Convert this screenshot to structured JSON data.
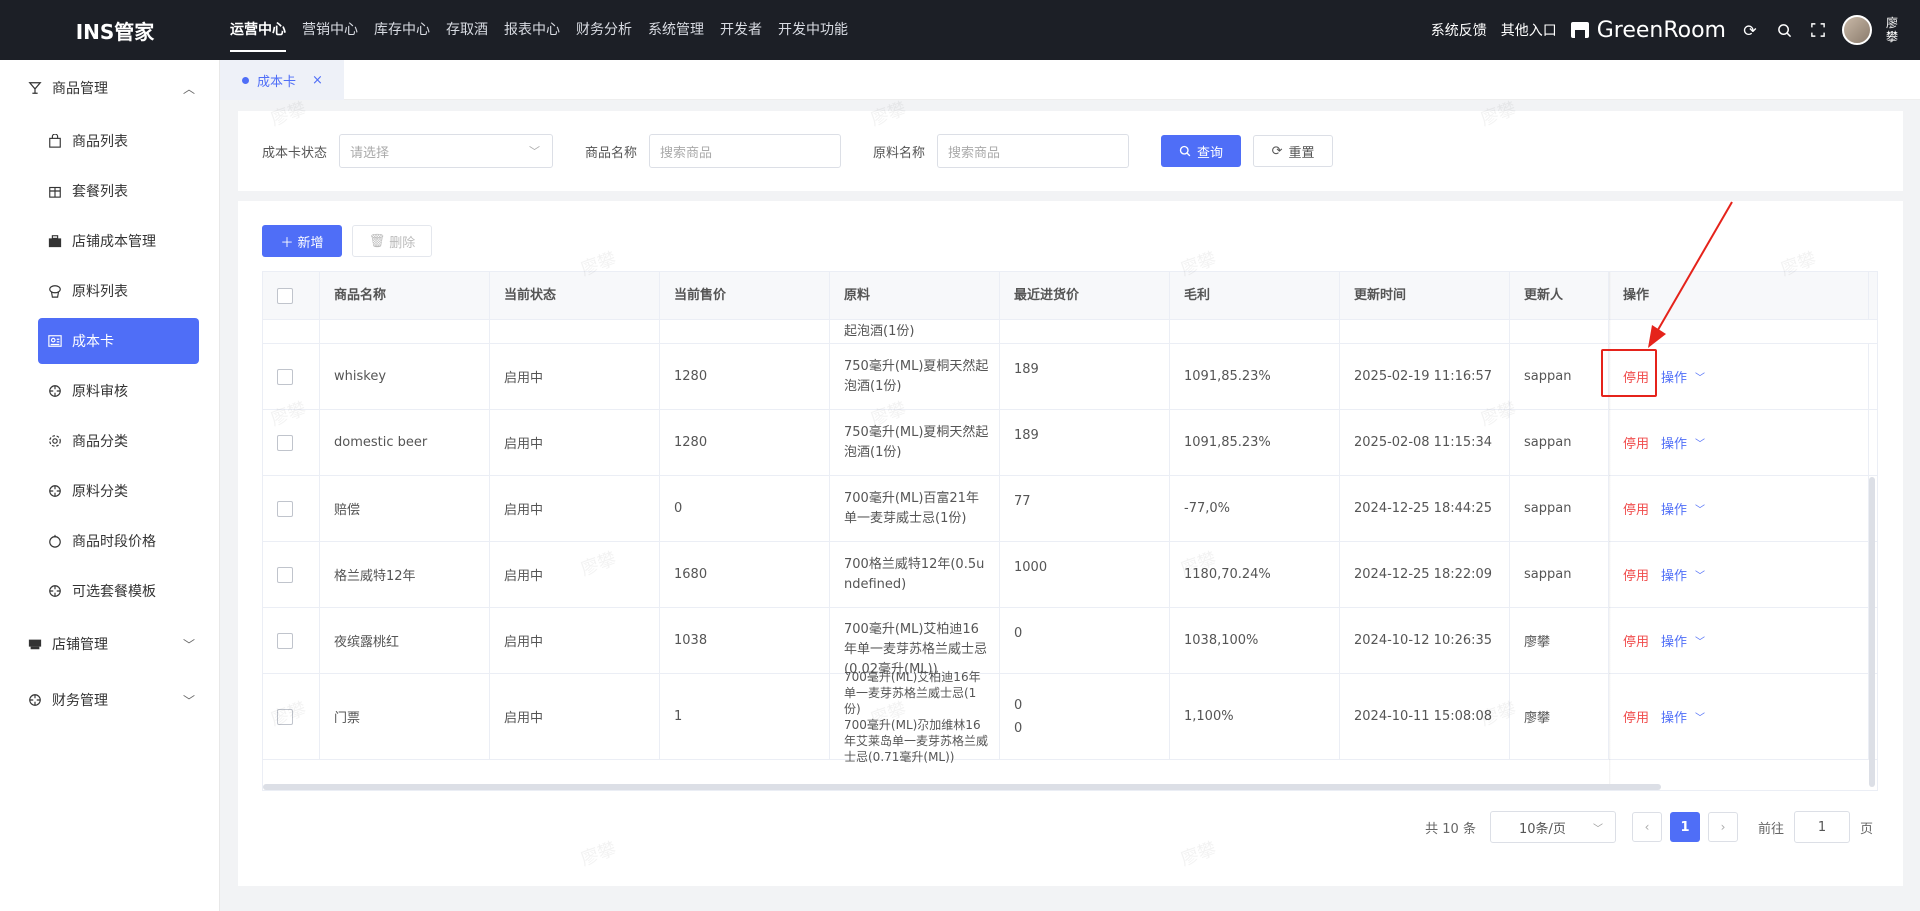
{
  "app": {
    "logo": "INS管家"
  },
  "topnav": [
    {
      "label": "运营中心",
      "active": true
    },
    {
      "label": "营销中心"
    },
    {
      "label": "库存中心"
    },
    {
      "label": "存取酒"
    },
    {
      "label": "报表中心"
    },
    {
      "label": "财务分析"
    },
    {
      "label": "系统管理"
    },
    {
      "label": "开发者"
    },
    {
      "label": "开发中功能"
    }
  ],
  "topbar": {
    "feedback": "系统反馈",
    "other_entry": "其他入口",
    "store_name": "GreenRoom",
    "username": "廖攀"
  },
  "sidebar": {
    "groups": [
      {
        "label": "商品管理",
        "expanded": true
      },
      {
        "label": "店铺管理"
      },
      {
        "label": "财务管理"
      }
    ],
    "items": [
      {
        "label": "商品列表",
        "icon": "bag-icon"
      },
      {
        "label": "套餐列表",
        "icon": "package-icon"
      },
      {
        "label": "店铺成本管理",
        "icon": "briefcase-icon"
      },
      {
        "label": "原料列表",
        "icon": "ingredient-icon"
      },
      {
        "label": "成本卡",
        "icon": "card-icon",
        "active": true
      },
      {
        "label": "原料审核",
        "icon": "crosshair-icon"
      },
      {
        "label": "商品分类",
        "icon": "gear-icon"
      },
      {
        "label": "原料分类",
        "icon": "crosshair-icon"
      },
      {
        "label": "商品时段价格",
        "icon": "clock-icon"
      },
      {
        "label": "可选套餐模板",
        "icon": "crosshair-icon"
      }
    ]
  },
  "tab": {
    "label": "成本卡",
    "close": "×"
  },
  "filter": {
    "status_label": "成本卡状态",
    "status_placeholder": "请选择",
    "product_label": "商品名称",
    "product_placeholder": "搜索商品",
    "material_label": "原料名称",
    "material_placeholder": "搜索商品",
    "query": "查询",
    "reset": "重置"
  },
  "actions": {
    "add": "新增",
    "delete": "删除"
  },
  "table": {
    "columns": [
      "商品名称",
      "当前状态",
      "当前售价",
      "原料",
      "最近进货价",
      "毛利",
      "更新时间",
      "更新人",
      "操作"
    ],
    "partial_top": "起泡酒(1份)",
    "rows": [
      {
        "name": "whiskey",
        "status": "启用中",
        "price": "1280",
        "material": "750毫升(ML)夏桐天然起泡酒(1份)",
        "cost": "189",
        "profit": "1091,85.23%",
        "time": "2025-02-19 11:16:57",
        "user": "sappan",
        "stop": "停用",
        "more": "操作"
      },
      {
        "name": "domestic beer",
        "status": "启用中",
        "price": "1280",
        "material": "750毫升(ML)夏桐天然起泡酒(1份)",
        "cost": "189",
        "profit": "1091,85.23%",
        "time": "2025-02-08 11:15:34",
        "user": "sappan",
        "stop": "停用",
        "more": "操作"
      },
      {
        "name": "赔偿",
        "status": "启用中",
        "price": "0",
        "material": "700毫升(ML)百富21年单一麦芽威士忌(1份)",
        "cost": "77",
        "profit": "-77,0%",
        "time": "2024-12-25 18:44:25",
        "user": "sappan",
        "stop": "停用",
        "more": "操作"
      },
      {
        "name": "格兰威特12年",
        "status": "启用中",
        "price": "1680",
        "material": "700格兰威特12年(0.5undefined)",
        "cost": "1000",
        "profit": "1180,70.24%",
        "time": "2024-12-25 18:22:09",
        "user": "sappan",
        "stop": "停用",
        "more": "操作"
      },
      {
        "name": "夜缤露桃红",
        "status": "启用中",
        "price": "1038",
        "material": "700毫升(ML)艾柏迪16年单一麦芽苏格兰威士忌(0.02毫升(ML))",
        "cost": "0",
        "profit": "1038,100%",
        "time": "2024-10-12 10:26:35",
        "user": "廖攀",
        "stop": "停用",
        "more": "操作"
      },
      {
        "name": "门票",
        "status": "启用中",
        "price": "1",
        "material": "700毫升(ML)艾柏迪16年单一麦芽苏格兰威士忌(1份)",
        "material2": "700毫升(ML)尕加维林16年艾莱岛单一麦芽苏格兰威士忌(0.71毫升(ML))",
        "cost": "0",
        "cost2": "0",
        "profit": "1,100%",
        "time": "2024-10-11 15:08:08",
        "user": "廖攀",
        "stop": "停用",
        "more": "操作"
      }
    ]
  },
  "pager": {
    "total": "共 10 条",
    "size": "10条/页",
    "current": "1",
    "goto": "前往",
    "goto_value": "1",
    "page_suffix": "页"
  },
  "watermark": "廖攀",
  "colors": {
    "primary": "#4f6ef7",
    "danger": "#f04b4b",
    "topbar": "#1c1f26",
    "annotation": "#e5231b"
  }
}
